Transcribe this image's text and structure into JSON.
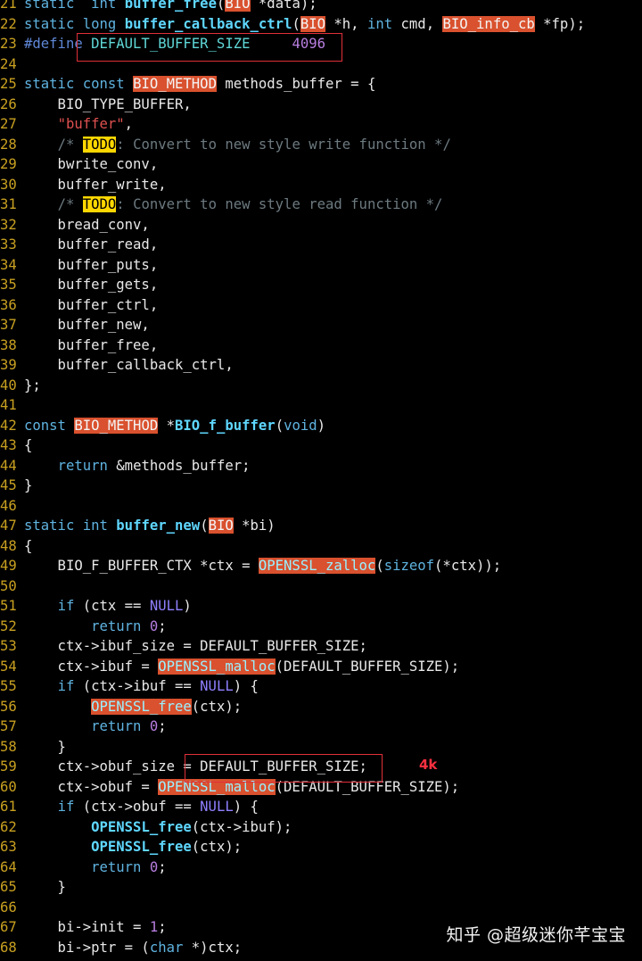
{
  "editor": {
    "lines": [
      {
        "n": "21",
        "tokens": [
          [
            "kw",
            "static"
          ],
          [
            "",
            "  "
          ],
          [
            "kw",
            "int"
          ],
          [
            "",
            " "
          ],
          [
            "fn",
            "buffer_free"
          ],
          [
            "",
            "("
          ],
          [
            "hl",
            "BIO"
          ],
          [
            "",
            " *data);"
          ]
        ]
      },
      {
        "n": "22",
        "tokens": [
          [
            "kw",
            "static"
          ],
          [
            "",
            " "
          ],
          [
            "kw",
            "long"
          ],
          [
            "",
            " "
          ],
          [
            "fn",
            "buffer_callback_ctrl"
          ],
          [
            "",
            "("
          ],
          [
            "hl",
            "BIO"
          ],
          [
            "",
            " *h, "
          ],
          [
            "kw",
            "int"
          ],
          [
            "",
            " cmd, "
          ],
          [
            "hl",
            "BIO_info_cb"
          ],
          [
            "",
            " *fp);"
          ]
        ]
      },
      {
        "n": "23",
        "tokens": [
          [
            "pp",
            "#define"
          ],
          [
            "kw2",
            " DEFAULT_BUFFER_SIZE     "
          ],
          [
            "num",
            "4096"
          ]
        ]
      },
      {
        "n": "24",
        "tokens": []
      },
      {
        "n": "25",
        "tokens": [
          [
            "kw",
            "static"
          ],
          [
            "",
            " "
          ],
          [
            "kw",
            "const"
          ],
          [
            "",
            " "
          ],
          [
            "hl",
            "BIO_METHOD"
          ],
          [
            "",
            " methods_buffer = {"
          ]
        ]
      },
      {
        "n": "26",
        "tokens": [
          [
            "",
            "    BIO_TYPE_BUFFER,"
          ]
        ]
      },
      {
        "n": "27",
        "tokens": [
          [
            "",
            "    "
          ],
          [
            "str",
            "\"buffer\""
          ],
          [
            "",
            ","
          ]
        ]
      },
      {
        "n": "28",
        "tokens": [
          [
            "",
            "    "
          ],
          [
            "cm",
            "/* "
          ],
          [
            "todo",
            "TODO"
          ],
          [
            "cm",
            ": Convert to new style write function */"
          ]
        ]
      },
      {
        "n": "29",
        "tokens": [
          [
            "",
            "    bwrite_conv,"
          ]
        ]
      },
      {
        "n": "30",
        "tokens": [
          [
            "",
            "    buffer_write,"
          ]
        ]
      },
      {
        "n": "31",
        "tokens": [
          [
            "",
            "    "
          ],
          [
            "cm",
            "/* "
          ],
          [
            "todo",
            "TODO"
          ],
          [
            "cm",
            ": Convert to new style read function */"
          ]
        ]
      },
      {
        "n": "32",
        "tokens": [
          [
            "",
            "    bread_conv,"
          ]
        ]
      },
      {
        "n": "33",
        "tokens": [
          [
            "",
            "    buffer_read,"
          ]
        ]
      },
      {
        "n": "34",
        "tokens": [
          [
            "",
            "    buffer_puts,"
          ]
        ]
      },
      {
        "n": "35",
        "tokens": [
          [
            "",
            "    buffer_gets,"
          ]
        ]
      },
      {
        "n": "36",
        "tokens": [
          [
            "",
            "    buffer_ctrl,"
          ]
        ]
      },
      {
        "n": "37",
        "tokens": [
          [
            "",
            "    buffer_new,"
          ]
        ]
      },
      {
        "n": "38",
        "tokens": [
          [
            "",
            "    buffer_free,"
          ]
        ]
      },
      {
        "n": "39",
        "tokens": [
          [
            "",
            "    buffer_callback_ctrl,"
          ]
        ]
      },
      {
        "n": "40",
        "tokens": [
          [
            "",
            "};"
          ]
        ]
      },
      {
        "n": "41",
        "tokens": []
      },
      {
        "n": "42",
        "tokens": [
          [
            "kw",
            "const"
          ],
          [
            "",
            " "
          ],
          [
            "hl",
            "BIO_METHOD"
          ],
          [
            "",
            " *"
          ],
          [
            "fn",
            "BIO_f_buffer"
          ],
          [
            "",
            "("
          ],
          [
            "kw",
            "void"
          ],
          [
            "",
            ")"
          ]
        ]
      },
      {
        "n": "43",
        "tokens": [
          [
            "",
            "{"
          ]
        ]
      },
      {
        "n": "44",
        "tokens": [
          [
            "",
            "    "
          ],
          [
            "kw",
            "return"
          ],
          [
            "",
            " &methods_buffer;"
          ]
        ]
      },
      {
        "n": "45",
        "tokens": [
          [
            "",
            "}"
          ]
        ]
      },
      {
        "n": "46",
        "tokens": []
      },
      {
        "n": "47",
        "tokens": [
          [
            "kw",
            "static"
          ],
          [
            "",
            " "
          ],
          [
            "kw",
            "int"
          ],
          [
            "",
            " "
          ],
          [
            "fn",
            "buffer_new"
          ],
          [
            "",
            "("
          ],
          [
            "hl",
            "BIO"
          ],
          [
            "",
            " *bi)"
          ]
        ]
      },
      {
        "n": "48",
        "tokens": [
          [
            "",
            "{"
          ]
        ]
      },
      {
        "n": "49",
        "tokens": [
          [
            "",
            "    BIO_F_BUFFER_CTX *ctx = "
          ],
          [
            "hlc",
            "OPENSSL_zalloc"
          ],
          [
            "",
            "("
          ],
          [
            "kw",
            "sizeof"
          ],
          [
            "",
            "(*ctx));"
          ]
        ]
      },
      {
        "n": "50",
        "tokens": []
      },
      {
        "n": "51",
        "tokens": [
          [
            "",
            "    "
          ],
          [
            "kw",
            "if"
          ],
          [
            "",
            " (ctx == "
          ],
          [
            "nul",
            "NULL"
          ],
          [
            "",
            ")"
          ]
        ]
      },
      {
        "n": "52",
        "tokens": [
          [
            "",
            "        "
          ],
          [
            "kw",
            "return"
          ],
          [
            "",
            " "
          ],
          [
            "num",
            "0"
          ],
          [
            "",
            ";"
          ]
        ]
      },
      {
        "n": "53",
        "tokens": [
          [
            "",
            "    ctx->ibuf_size = DEFAULT_BUFFER_SIZE;"
          ]
        ]
      },
      {
        "n": "54",
        "tokens": [
          [
            "",
            "    ctx->ibuf = "
          ],
          [
            "hlc",
            "OPENSSL_malloc"
          ],
          [
            "",
            "(DEFAULT_BUFFER_SIZE);"
          ]
        ]
      },
      {
        "n": "55",
        "tokens": [
          [
            "",
            "    "
          ],
          [
            "kw",
            "if"
          ],
          [
            "",
            " (ctx->ibuf == "
          ],
          [
            "nul",
            "NULL"
          ],
          [
            "",
            ") {"
          ]
        ]
      },
      {
        "n": "56",
        "tokens": [
          [
            "",
            "        "
          ],
          [
            "hlc",
            "OPENSSL_free"
          ],
          [
            "",
            "(ctx);"
          ]
        ]
      },
      {
        "n": "57",
        "tokens": [
          [
            "",
            "        "
          ],
          [
            "kw",
            "return"
          ],
          [
            "",
            " "
          ],
          [
            "num",
            "0"
          ],
          [
            "",
            ";"
          ]
        ]
      },
      {
        "n": "58",
        "tokens": [
          [
            "",
            "    }"
          ]
        ]
      },
      {
        "n": "59",
        "tokens": [
          [
            "",
            "    ctx->obuf_size = DEFAULT_BUFFER_SIZE;"
          ]
        ]
      },
      {
        "n": "60",
        "tokens": [
          [
            "",
            "    ctx->obuf = "
          ],
          [
            "hlc",
            "OPENSSL_malloc"
          ],
          [
            "",
            "(DEFAULT_BUFFER_SIZE);"
          ]
        ]
      },
      {
        "n": "61",
        "tokens": [
          [
            "",
            "    "
          ],
          [
            "kw",
            "if"
          ],
          [
            "",
            " (ctx->obuf == "
          ],
          [
            "nul",
            "NULL"
          ],
          [
            "",
            ") {"
          ]
        ]
      },
      {
        "n": "62",
        "tokens": [
          [
            "",
            "        "
          ],
          [
            "fn",
            "OPENSSL_free"
          ],
          [
            "",
            "(ctx->ibuf);"
          ]
        ]
      },
      {
        "n": "63",
        "tokens": [
          [
            "",
            "        "
          ],
          [
            "fn",
            "OPENSSL_free"
          ],
          [
            "",
            "(ctx);"
          ]
        ]
      },
      {
        "n": "64",
        "tokens": [
          [
            "",
            "        "
          ],
          [
            "kw",
            "return"
          ],
          [
            "",
            " "
          ],
          [
            "num",
            "0"
          ],
          [
            "",
            ";"
          ]
        ]
      },
      {
        "n": "65",
        "tokens": [
          [
            "",
            "    }"
          ]
        ]
      },
      {
        "n": "66",
        "tokens": []
      },
      {
        "n": "67",
        "tokens": [
          [
            "",
            "    bi->init = "
          ],
          [
            "num",
            "1"
          ],
          [
            "",
            ";"
          ]
        ]
      },
      {
        "n": "68",
        "tokens": [
          [
            "",
            "    bi->ptr = ("
          ],
          [
            "kw",
            "char"
          ],
          [
            "",
            " *)ctx;"
          ]
        ]
      }
    ]
  },
  "annotation": {
    "label": "4k",
    "color": "#e0303a"
  },
  "watermark": "知乎 @超级迷你芊宝宝",
  "colors": {
    "background": "#000000",
    "line_number": "#c8a020",
    "highlight": "#d9512e",
    "todo": "#ffd700"
  }
}
